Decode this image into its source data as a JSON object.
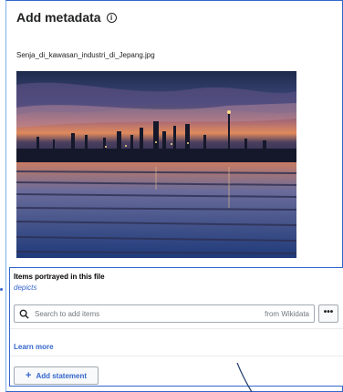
{
  "panel": {
    "title": "Add metadata",
    "info_icon": "info-icon",
    "filename": "Senja_di_kawasan_industri_di_Jepang.jpg"
  },
  "statement": {
    "title": "Items portrayed in this file",
    "property": "depicts",
    "search": {
      "icon": "search-icon",
      "placeholder": "Search to add items",
      "suffix": "from Wikidata"
    },
    "more_label": "•••",
    "learn_more": "Learn more"
  },
  "add_statement": {
    "icon": "plus-icon",
    "label": "Add statement"
  },
  "colors": {
    "accent": "#3366cc",
    "border": "#a2a9b1"
  }
}
